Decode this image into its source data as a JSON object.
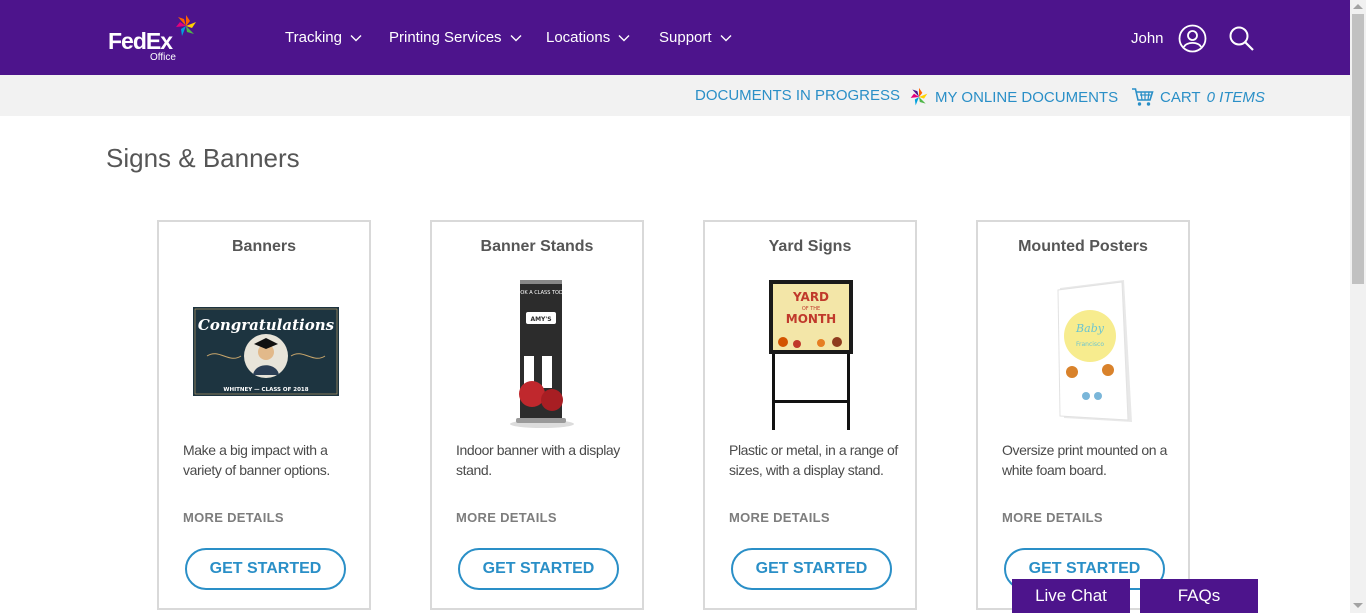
{
  "brand": {
    "logo_text": "FedEx",
    "logo_sub": "Office",
    "primary_color": "#4d148c",
    "link_color": "#2a8fc7"
  },
  "nav": {
    "items": [
      {
        "label": "Tracking"
      },
      {
        "label": "Printing Services"
      },
      {
        "label": "Locations"
      },
      {
        "label": "Support"
      }
    ],
    "user_name": "John"
  },
  "subnav": {
    "documents_in_progress": "DOCUMENTS IN PROGRESS",
    "my_online_documents": "MY ONLINE DOCUMENTS",
    "cart_label": "CART",
    "cart_count": "0 ITEMS"
  },
  "page": {
    "title": "Signs & Banners"
  },
  "cards": [
    {
      "title": "Banners",
      "description": "Make a big impact with a variety of banner options.",
      "more": "MORE DETAILS",
      "cta": "GET STARTED",
      "image_text": [
        "Congratulations",
        "WHITNEY — CLASS OF 2018"
      ]
    },
    {
      "title": "Banner Stands",
      "description": "Indoor banner with a display stand.",
      "more": "MORE DETAILS",
      "cta": "GET STARTED",
      "image_text": [
        "BOOK A CLASS TODAY",
        "AMY'S"
      ]
    },
    {
      "title": "Yard Signs",
      "description": "Plastic or metal, in a range of sizes, with a display stand.",
      "more": "MORE DETAILS",
      "cta": "GET STARTED",
      "image_text": [
        "YARD",
        "OF THE",
        "MONTH"
      ]
    },
    {
      "title": "Mounted Posters",
      "description": "Oversize print mounted on a white foam board.",
      "more": "MORE DETAILS",
      "cta": "GET STARTED",
      "image_text": [
        "Baby",
        "Francisco"
      ]
    }
  ],
  "floating": {
    "live_chat": "Live Chat",
    "faqs": "FAQs"
  }
}
